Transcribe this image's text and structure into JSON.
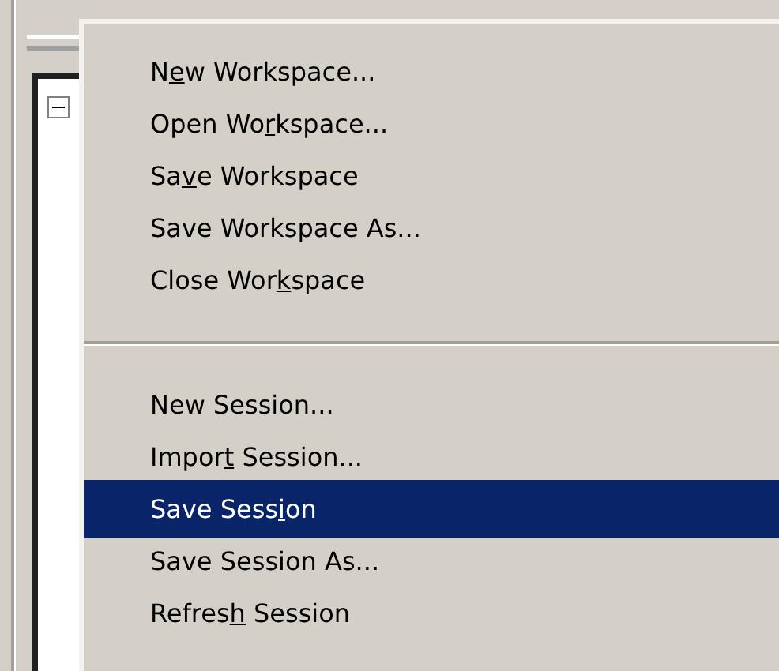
{
  "menu": {
    "groups": [
      {
        "items": [
          {
            "pre": "N",
            "key": "e",
            "post": "w Workspace...",
            "selected": false
          },
          {
            "pre": "Open Wo",
            "key": "r",
            "post": "kspace...",
            "selected": false
          },
          {
            "pre": "Sa",
            "key": "v",
            "post": "e Workspace",
            "selected": false
          },
          {
            "pre": "Save Workspace As...",
            "selected": false
          },
          {
            "pre": "Close Wor",
            "key": "k",
            "post": "space",
            "selected": false
          }
        ]
      },
      {
        "items": [
          {
            "pre": "New Session...",
            "selected": false
          },
          {
            "pre": "Impor",
            "key": "t",
            "post": " Session...",
            "selected": false
          },
          {
            "pre": "Save Sess",
            "key": "i",
            "post": "on",
            "selected": true
          },
          {
            "pre": "Save Session As...",
            "selected": false
          },
          {
            "pre": "Refres",
            "key": "h",
            "post": " Session",
            "selected": false
          }
        ]
      }
    ]
  }
}
